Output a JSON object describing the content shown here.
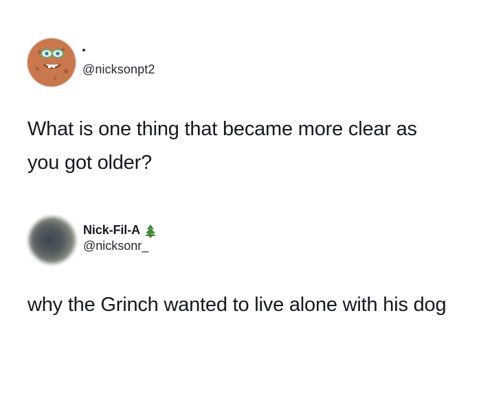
{
  "post1": {
    "avatar_icon": "spongebob-avatar-icon",
    "handle": "@nicksonpt2",
    "question": "What is one thing that became more clear as you got older?"
  },
  "post2": {
    "avatar_icon": "profile-photo-avatar-icon",
    "display_name": "Nick-Fil-A",
    "badge_icon": "christmas-tree-icon",
    "handle": "@nicksonr_",
    "answer": "why the Grinch wanted to live alone with his dog"
  },
  "colors": {
    "text": "#141823",
    "background": "#ffffff",
    "tree_green": "#3a8a3a"
  }
}
